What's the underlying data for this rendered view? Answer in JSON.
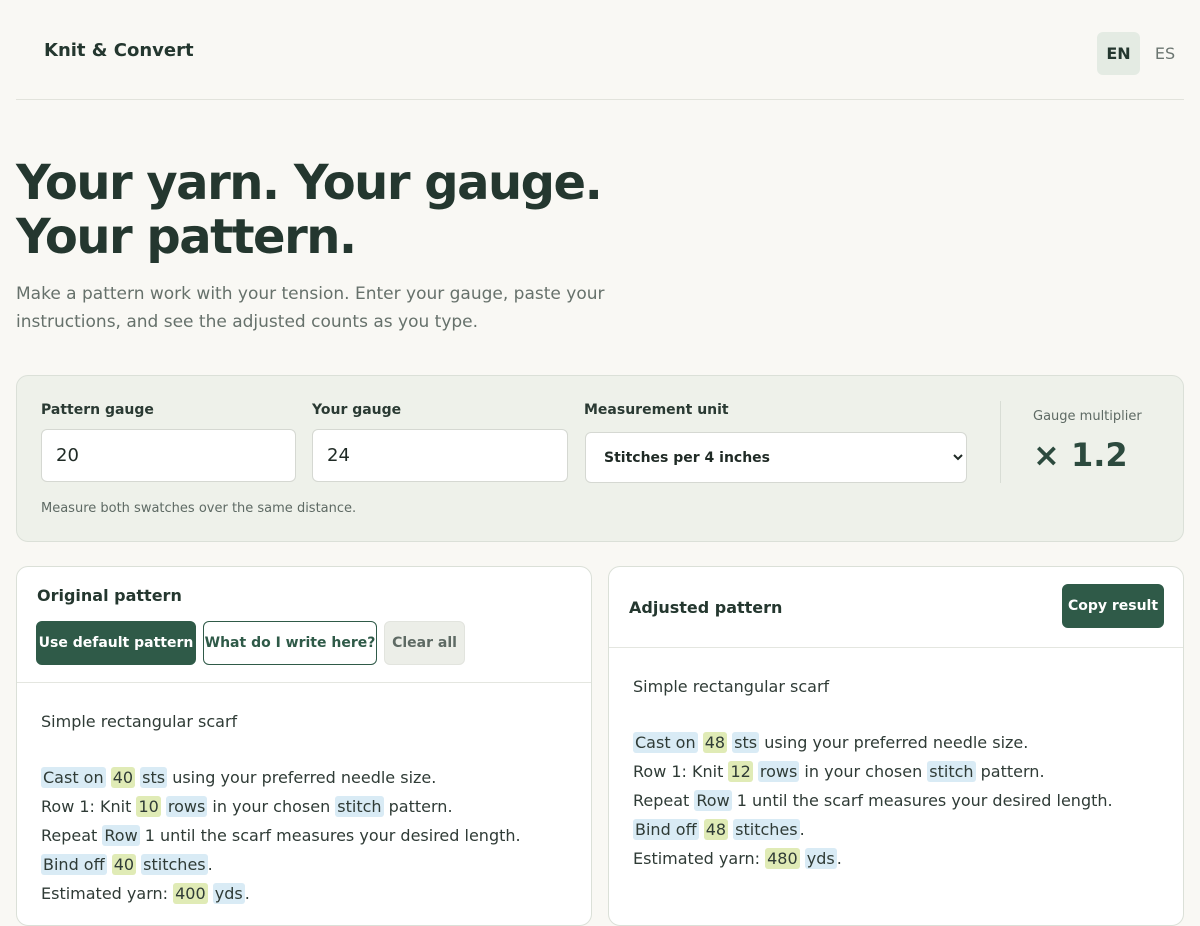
{
  "header": {
    "brand": "Knit & Convert",
    "languages": [
      {
        "label": "EN",
        "active": true
      },
      {
        "label": "ES",
        "active": false
      }
    ]
  },
  "hero": {
    "title": "Your yarn. Your gauge. Your pattern.",
    "subtitle": "Make a pattern work with your tension. Enter your gauge, paste your instructions, and see the adjusted counts as you type."
  },
  "gauge": {
    "pattern_label": "Pattern gauge",
    "pattern_value": "20",
    "your_label": "Your gauge",
    "your_value": "24",
    "unit_label": "Measurement unit",
    "unit_selected": "Stitches per 4 inches",
    "multiplier_label": "Gauge multiplier",
    "multiplier_value": "× 1.2",
    "hint": "Measure both swatches over the same distance."
  },
  "original": {
    "title": "Original pattern",
    "buttons": {
      "default": "Use default pattern",
      "help": "What do I write here?",
      "clear": "Clear all"
    },
    "pattern_title": "Simple rectangular scarf",
    "lines": [
      {
        "t1": "Cast on",
        "n1": "40",
        "t2": "sts",
        "rest": " using your preferred needle size."
      },
      {
        "pre": "Row 1: Knit ",
        "n1": "10",
        "t1": "rows",
        "mid": " in your chosen ",
        "t2": "stitch",
        "rest": " pattern."
      },
      {
        "pre": "Repeat ",
        "t1": "Row",
        "rest": " 1 until the scarf measures your desired length."
      },
      {
        "t1": "Bind off",
        "n1": "40",
        "t2": "stitches",
        "rest": "."
      },
      {
        "pre": "Estimated yarn: ",
        "n1": "400",
        "t1": "yds",
        "rest": "."
      }
    ]
  },
  "adjusted": {
    "title": "Adjusted pattern",
    "copy_button": "Copy result",
    "pattern_title": "Simple rectangular scarf",
    "lines": [
      {
        "t1": "Cast on",
        "n1": "48",
        "t2": "sts",
        "rest": " using your preferred needle size."
      },
      {
        "pre": "Row 1: Knit ",
        "n1": "12",
        "t1": "rows",
        "mid": " in your chosen ",
        "t2": "stitch",
        "rest": " pattern."
      },
      {
        "pre": "Repeat ",
        "t1": "Row",
        "rest": " 1 until the scarf measures your desired length."
      },
      {
        "t1": "Bind off",
        "n1": "48",
        "t2": "stitches",
        "rest": "."
      },
      {
        "pre": "Estimated yarn: ",
        "n1": "480",
        "t1": "yds",
        "rest": "."
      }
    ]
  },
  "colors": {
    "accent": "#2f5a48",
    "term_highlight": "#d9ebf5",
    "number_highlight": "#e0ebb6",
    "panel_bg": "#eef1ea"
  }
}
